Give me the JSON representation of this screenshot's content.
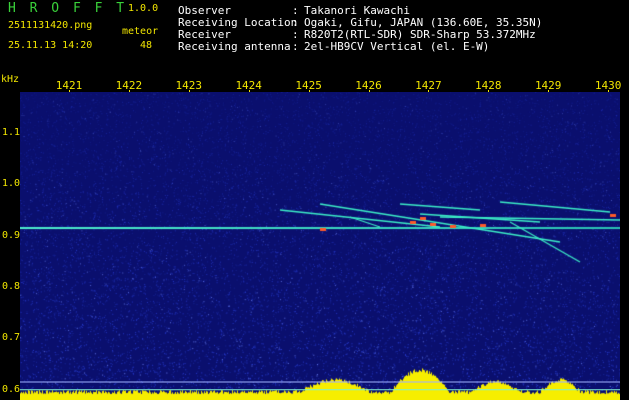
{
  "header": {
    "app_title": "H R O F F T",
    "app_version": "1.0.0",
    "file_name": "2511131420.png",
    "datetime": "25.11.13 14:20",
    "meteor_label": "meteor",
    "meteor_count": "48"
  },
  "info": [
    {
      "label": "Observer",
      "value": "Takanori Kawachi"
    },
    {
      "label": "Receiving Location",
      "value": "Ogaki, Gifu, JAPAN (136.60E, 35.35N)"
    },
    {
      "label": "Receiver",
      "value": "R820T2(RTL-SDR) SDR-Sharp 53.372MHz"
    },
    {
      "label": "Receiving antenna",
      "value": "2el-HB9CV Vertical (el. E-W)"
    }
  ],
  "chart_data": {
    "type": "heatmap",
    "y_unit": "kHz",
    "x_ticks": [
      "1421",
      "1422",
      "1423",
      "1424",
      "1425",
      "1426",
      "1427",
      "1428",
      "1429",
      "1430"
    ],
    "y_ticks": [
      "1.1",
      "1.0",
      "0.9",
      "0.8",
      "0.7",
      "0.6"
    ],
    "ylim": [
      0.58,
      1.18
    ],
    "carrier_khz": 0.915,
    "colors": {
      "background": "#0a0f6e",
      "noise": "#2a3fd8",
      "echo": "#3cf0c8",
      "echo_hot": "#ff5a2a",
      "power_level": "#f6ee00"
    }
  }
}
